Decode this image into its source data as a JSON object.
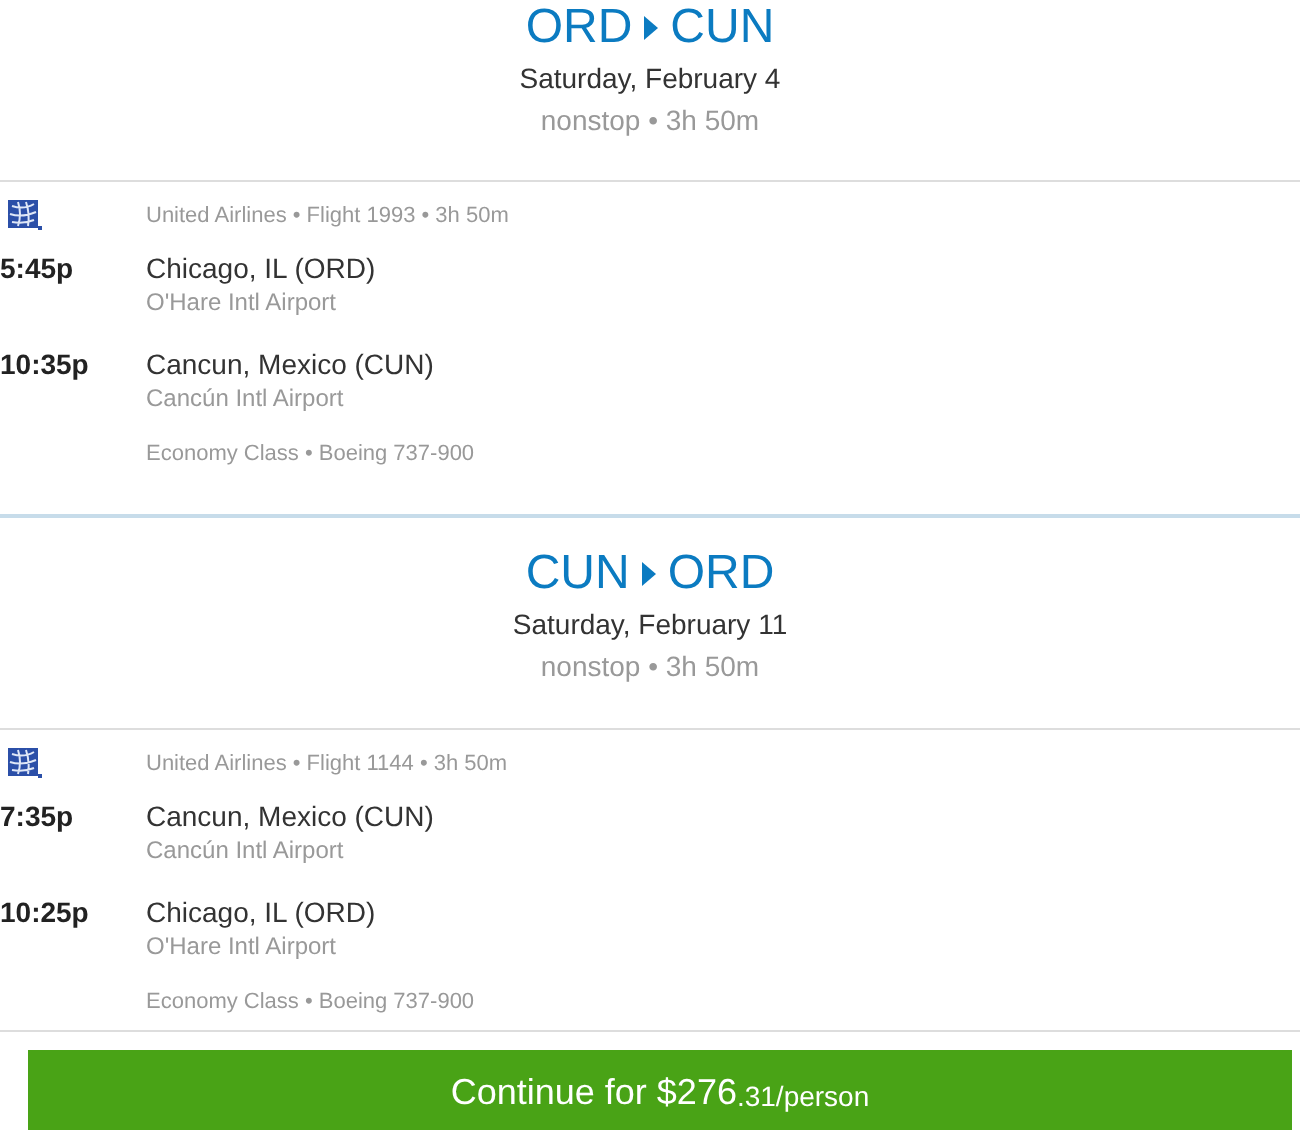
{
  "legs": [
    {
      "origin": "ORD",
      "destination": "CUN",
      "date": "Saturday, February 4",
      "summary": "nonstop • 3h 50m",
      "flight_info": "United Airlines • Flight 1993 • 3h 50m",
      "departure": {
        "time": "5:45p",
        "city": "Chicago, IL (ORD)",
        "airport": "O'Hare Intl Airport"
      },
      "arrival": {
        "time": "10:35p",
        "city": "Cancun, Mexico (CUN)",
        "airport": "Cancún Intl Airport"
      },
      "details": "Economy Class • Boeing 737-900"
    },
    {
      "origin": "CUN",
      "destination": "ORD",
      "date": "Saturday, February 11",
      "summary": "nonstop • 3h 50m",
      "flight_info": "United Airlines • Flight 1144 • 3h 50m",
      "departure": {
        "time": "7:35p",
        "city": "Cancun, Mexico (CUN)",
        "airport": "Cancún Intl Airport"
      },
      "arrival": {
        "time": "10:25p",
        "city": "Chicago, IL (ORD)",
        "airport": "O'Hare Intl Airport"
      },
      "details": "Economy Class • Boeing 737-900"
    }
  ],
  "continue_button": {
    "label": "Continue for",
    "price": "$276",
    "price_suffix": ".31/person"
  }
}
